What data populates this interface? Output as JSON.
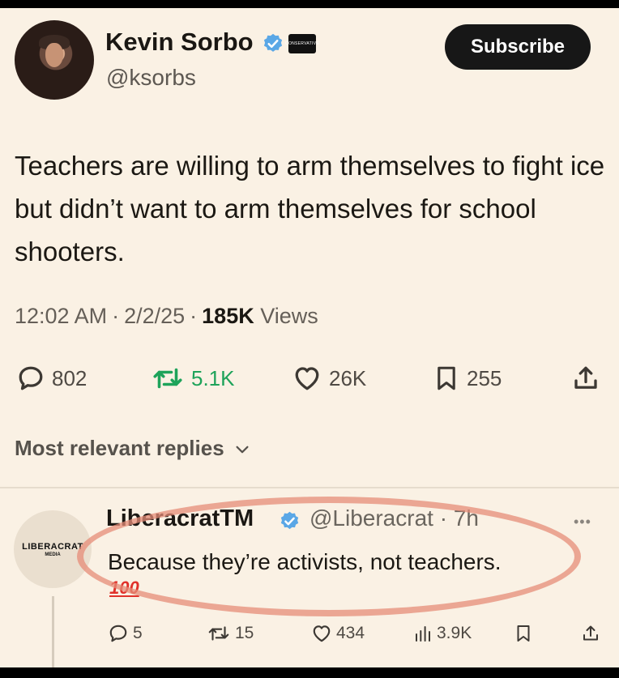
{
  "tweet": {
    "author_name": "Kevin Sorbo",
    "author_handle": "@ksorbs",
    "affiliate_badge_text": "CONSERVATIVE",
    "subscribe_label": "Subscribe",
    "text": "Teachers are willing to arm themselves to fight ice but didn’t want to arm themselves for school shooters.",
    "time": "12:02 AM",
    "date": "2/2/25",
    "views_count": "185K",
    "views_label": "Views",
    "replies": "802",
    "retweets": "5.1K",
    "likes": "26K",
    "bookmarks": "255"
  },
  "replies_section": {
    "label": "Most relevant replies"
  },
  "reply": {
    "author_name": "LiberacratTM",
    "author_handle": "@Liberacrat",
    "time": "7h",
    "text": "Because they’re activists, not teachers.",
    "emoji": "100",
    "avatar_logo_main": "LIBERACRAT",
    "avatar_logo_sub": "MEDIA",
    "replies": "5",
    "retweets": "15",
    "likes": "434",
    "views": "3.9K"
  },
  "icons": {
    "reply": "speech-bubble-icon",
    "retweet": "retweet-icon",
    "like": "heart-icon",
    "bookmark": "bookmark-icon",
    "share": "share-icon",
    "views": "bar-chart-icon",
    "verified": "verified-badge-icon",
    "more": "more-dots-icon"
  },
  "colors": {
    "background": "#faf1e4",
    "verified_blue": "#5aa7e6",
    "retweet_green": "#1ea35a",
    "highlight": "#e68c78",
    "emoji_red": "#e0312a"
  }
}
